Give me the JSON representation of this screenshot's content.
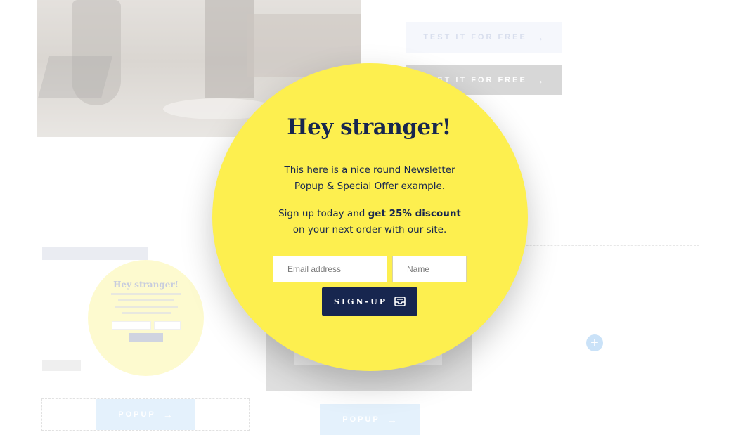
{
  "background": {
    "cta_top_label": "TEST IT FOR FREE",
    "cta_second_label": "TEST IT FOR FREE",
    "popup_left_label": "POPUP",
    "popup_mid_label": "POPUP",
    "mini_preview_title": "Hey stranger!",
    "arrow_glyph": "→",
    "add_glyph": "+"
  },
  "popup": {
    "title": "Hey stranger!",
    "line1": "This here is a nice round Newsletter",
    "line2": "Popup & Special Offer example.",
    "offer_prefix": "Sign up today and",
    "offer_bold": "get 25% discount",
    "offer_suffix": "on your next order with our site.",
    "email_placeholder": "Email address",
    "name_placeholder": "Name",
    "signup_label": "SIGN-UP",
    "signup_icon": "inbox-icon"
  },
  "colors": {
    "popup_bg": "#fdef4f",
    "navy": "#17264f",
    "popup_button_bg": "#cfe6fb"
  }
}
